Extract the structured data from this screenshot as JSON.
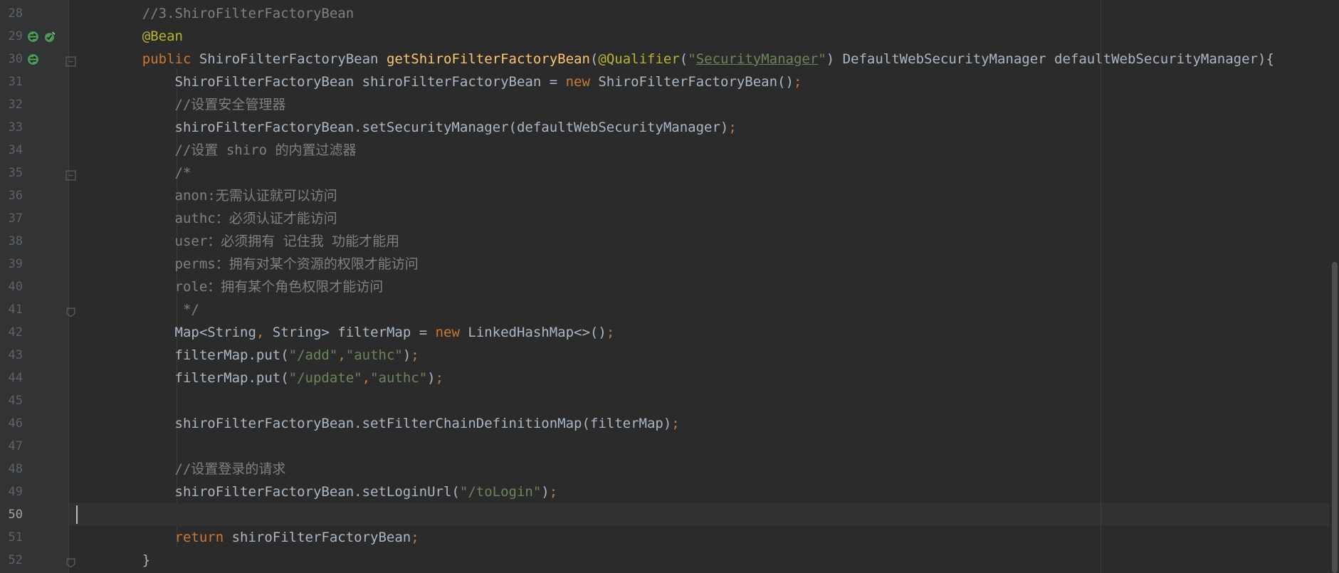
{
  "editor": {
    "current_line": 50,
    "lines": [
      {
        "num": "28",
        "tokens": [
          {
            "t": "    //3.ShiroFilterFactoryBean",
            "c": "cm"
          }
        ]
      },
      {
        "num": "29",
        "tokens": [
          {
            "t": "    @Bean",
            "c": "an"
          }
        ]
      },
      {
        "num": "30",
        "tokens": [
          {
            "t": "    ",
            "c": "pl"
          },
          {
            "t": "public ",
            "c": "kw"
          },
          {
            "t": "ShiroFilterFactoryBean ",
            "c": "pl"
          },
          {
            "t": "getShiroFilterFactoryBean",
            "c": "fn"
          },
          {
            "t": "(",
            "c": "pl"
          },
          {
            "t": "@Qualifier",
            "c": "an"
          },
          {
            "t": "(",
            "c": "pl"
          },
          {
            "t": "\"",
            "c": "st"
          },
          {
            "t": "SecurityManager",
            "c": "stu"
          },
          {
            "t": "\"",
            "c": "st"
          },
          {
            "t": ") DefaultWebSecurityManager defaultWebSecurityManager){",
            "c": "pl"
          }
        ]
      },
      {
        "num": "31",
        "tokens": [
          {
            "t": "        ShiroFilterFactoryBean shiroFilterFactoryBean = ",
            "c": "pl"
          },
          {
            "t": "new ",
            "c": "kw"
          },
          {
            "t": "ShiroFilterFactoryBean()",
            "c": "pl"
          },
          {
            "t": ";",
            "c": "kw"
          }
        ]
      },
      {
        "num": "32",
        "tokens": [
          {
            "t": "        //设置安全管理器",
            "c": "cm"
          }
        ]
      },
      {
        "num": "33",
        "tokens": [
          {
            "t": "        shiroFilterFactoryBean.setSecurityManager(defaultWebSecurityManager)",
            "c": "pl"
          },
          {
            "t": ";",
            "c": "kw"
          }
        ]
      },
      {
        "num": "34",
        "tokens": [
          {
            "t": "        //设置 shiro 的内置过滤器",
            "c": "cm"
          }
        ]
      },
      {
        "num": "35",
        "tokens": [
          {
            "t": "        /*",
            "c": "cm"
          }
        ]
      },
      {
        "num": "36",
        "tokens": [
          {
            "t": "        anon:无需认证就可以访问",
            "c": "cm"
          }
        ]
      },
      {
        "num": "37",
        "tokens": [
          {
            "t": "        authc：必须认证才能访问",
            "c": "cm"
          }
        ]
      },
      {
        "num": "38",
        "tokens": [
          {
            "t": "        user：必须拥有 记住我 功能才能用",
            "c": "cm"
          }
        ]
      },
      {
        "num": "39",
        "tokens": [
          {
            "t": "        perms：拥有对某个资源的权限才能访问",
            "c": "cm"
          }
        ]
      },
      {
        "num": "40",
        "tokens": [
          {
            "t": "        role：拥有某个角色权限才能访问",
            "c": "cm"
          }
        ]
      },
      {
        "num": "41",
        "tokens": [
          {
            "t": "         */",
            "c": "cm"
          }
        ]
      },
      {
        "num": "42",
        "tokens": [
          {
            "t": "        Map<String",
            "c": "pl"
          },
          {
            "t": ", ",
            "c": "kw"
          },
          {
            "t": "String> filterMap = ",
            "c": "pl"
          },
          {
            "t": "new ",
            "c": "kw"
          },
          {
            "t": "LinkedHashMap<>()",
            "c": "pl"
          },
          {
            "t": ";",
            "c": "kw"
          }
        ]
      },
      {
        "num": "43",
        "tokens": [
          {
            "t": "        filterMap.put(",
            "c": "pl"
          },
          {
            "t": "\"/add\"",
            "c": "st"
          },
          {
            "t": ",",
            "c": "kw"
          },
          {
            "t": "\"authc\"",
            "c": "st"
          },
          {
            "t": ")",
            "c": "pl"
          },
          {
            "t": ";",
            "c": "kw"
          }
        ]
      },
      {
        "num": "44",
        "tokens": [
          {
            "t": "        filterMap.put(",
            "c": "pl"
          },
          {
            "t": "\"/update\"",
            "c": "st"
          },
          {
            "t": ",",
            "c": "kw"
          },
          {
            "t": "\"authc\"",
            "c": "st"
          },
          {
            "t": ")",
            "c": "pl"
          },
          {
            "t": ";",
            "c": "kw"
          }
        ]
      },
      {
        "num": "45",
        "tokens": []
      },
      {
        "num": "46",
        "tokens": [
          {
            "t": "        shiroFilterFactoryBean.setFilterChainDefinitionMap(filterMap)",
            "c": "pl"
          },
          {
            "t": ";",
            "c": "kw"
          }
        ]
      },
      {
        "num": "47",
        "tokens": []
      },
      {
        "num": "48",
        "tokens": [
          {
            "t": "        //设置登录的请求",
            "c": "cm"
          }
        ]
      },
      {
        "num": "49",
        "tokens": [
          {
            "t": "        shiroFilterFactoryBean.setLoginUrl(",
            "c": "pl"
          },
          {
            "t": "\"/toLogin\"",
            "c": "st"
          },
          {
            "t": ")",
            "c": "pl"
          },
          {
            "t": ";",
            "c": "kw"
          }
        ]
      },
      {
        "num": "50",
        "tokens": []
      },
      {
        "num": "51",
        "tokens": [
          {
            "t": "        ",
            "c": "pl"
          },
          {
            "t": "return ",
            "c": "kw"
          },
          {
            "t": "shiroFilterFactoryBean",
            "c": "pl"
          },
          {
            "t": ";",
            "c": "kw"
          }
        ]
      },
      {
        "num": "52",
        "tokens": [
          {
            "t": "    }",
            "c": "pl"
          }
        ]
      }
    ]
  },
  "gutter_icons": {
    "29": [
      "implemented-bean-icon",
      "injection-point-icon"
    ],
    "30": [
      "bean-method-icon"
    ]
  },
  "fold_markers": {
    "30": "fold-open-icon",
    "35": "fold-open-icon",
    "41": "fold-close-icon",
    "52": "fold-close-icon"
  },
  "colors": {
    "background": "#2b2b2b",
    "gutter": "#313335",
    "keyword": "#cc7832",
    "string": "#6a8759",
    "comment": "#808080",
    "annotation": "#bbb529",
    "function": "#ffc66d",
    "plain": "#a9b7c6"
  }
}
